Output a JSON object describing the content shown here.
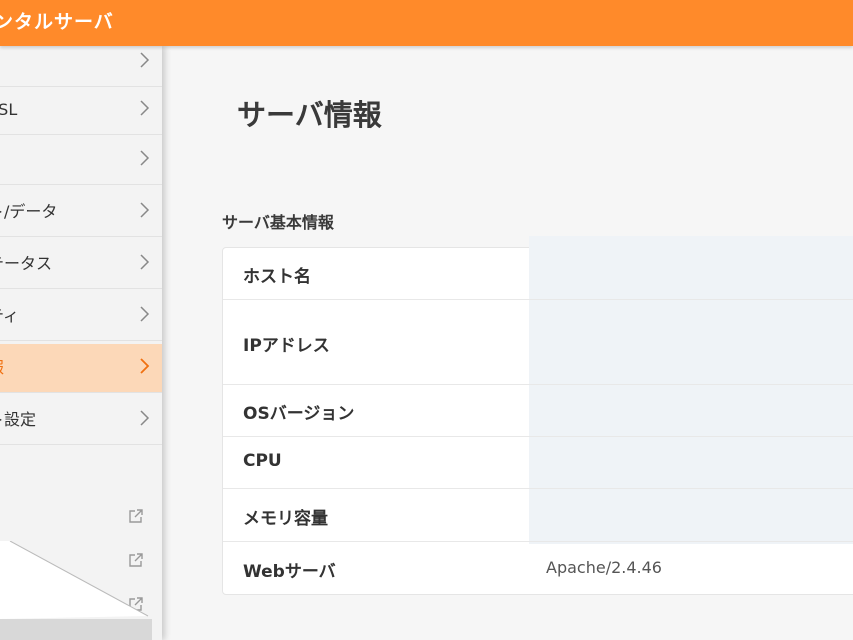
{
  "header": {
    "brand": "ンタルサーバ",
    "color": "#ff8a2a"
  },
  "sidebar": {
    "items": [
      {
        "label": "",
        "active": false
      },
      {
        "label": "SSL",
        "active": false
      },
      {
        "label": "",
        "active": false
      },
      {
        "label": "ト/データ",
        "active": false
      },
      {
        "label": "テータス",
        "active": false
      },
      {
        "label": "ティ",
        "active": false
      },
      {
        "label": "報",
        "active": true
      },
      {
        "label": "ト設定",
        "active": false
      }
    ],
    "external_links": [
      "external-link-icon",
      "external-link-icon",
      "external-link-icon"
    ]
  },
  "main": {
    "page_title": "サーバ情報",
    "section_title": "サーバ基本情報",
    "rows": [
      {
        "key": "ホスト名",
        "value": ""
      },
      {
        "key": "IPアドレス",
        "value": ""
      },
      {
        "key": "OSバージョン",
        "value": ""
      },
      {
        "key": "CPU",
        "value": ""
      },
      {
        "key": "メモリ容量",
        "value": ""
      },
      {
        "key": "Webサーバ",
        "value": "Apache/2.4.46"
      }
    ]
  },
  "colors": {
    "accent": "#ff8a2a",
    "active_bg": "#fcd8b8",
    "active_text": "#f07010"
  }
}
